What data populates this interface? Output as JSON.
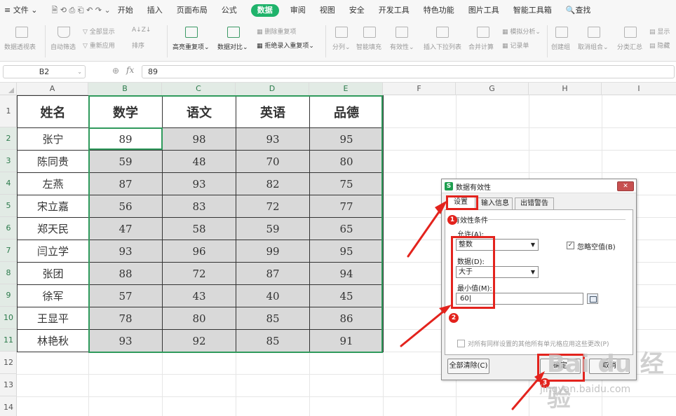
{
  "menu": {
    "file": "文件",
    "tabs": [
      "开始",
      "插入",
      "页面布局",
      "公式",
      "数据",
      "审阅",
      "视图",
      "安全",
      "开发工具",
      "特色功能",
      "图片工具",
      "智能工具箱"
    ],
    "active_tab": "数据",
    "search": "查找"
  },
  "ribbon": {
    "pivot": "数据透视表",
    "autofilter": "自动筛选",
    "show_all": "全部显示",
    "reapply": "重新应用",
    "sort": "排序",
    "highlight_dup": "高亮重复项",
    "compare": "数据对比",
    "remove_dup": "删除重复项",
    "reject_dup": "拒绝录入重复项",
    "split": "分列",
    "smart_fill": "智能填充",
    "validity": "有效性",
    "dropdown": "插入下拉列表",
    "consolidate": "合并计算",
    "whatif": "模拟分析",
    "record": "记录单",
    "group": "创建组",
    "ungroup": "取消组合",
    "subtotal": "分类汇总",
    "show_detail": "显示",
    "hide_detail": "隐藏"
  },
  "formula_bar": {
    "name_box": "B2",
    "fx": "fx",
    "value": "89"
  },
  "columns": [
    "A",
    "B",
    "C",
    "D",
    "E",
    "F",
    "G",
    "H",
    "I"
  ],
  "rows": [
    "1",
    "2",
    "3",
    "4",
    "5",
    "6",
    "7",
    "8",
    "9",
    "10",
    "11",
    "12",
    "13",
    "14"
  ],
  "table": {
    "headers": [
      "姓名",
      "数学",
      "语文",
      "英语",
      "品德"
    ],
    "rows": [
      [
        "张宁",
        "89",
        "98",
        "93",
        "95"
      ],
      [
        "陈同贵",
        "59",
        "48",
        "70",
        "80"
      ],
      [
        "左燕",
        "87",
        "93",
        "82",
        "75"
      ],
      [
        "宋立嘉",
        "56",
        "83",
        "72",
        "77"
      ],
      [
        "郑天民",
        "47",
        "58",
        "59",
        "65"
      ],
      [
        "闫立学",
        "93",
        "96",
        "99",
        "95"
      ],
      [
        "张团",
        "88",
        "72",
        "87",
        "94"
      ],
      [
        "徐军",
        "57",
        "43",
        "40",
        "45"
      ],
      [
        "王显平",
        "78",
        "80",
        "85",
        "86"
      ],
      [
        "林艳秋",
        "93",
        "92",
        "85",
        "91"
      ]
    ]
  },
  "dialog": {
    "title": "数据有效性",
    "tabs": [
      "设置",
      "输入信息",
      "出错警告"
    ],
    "group": "有效性条件",
    "allow_label": "允许(A):",
    "allow_value": "整数",
    "ignore_blank": "忽略空值(B)",
    "data_label": "数据(D):",
    "data_value": "大于",
    "min_label": "最小值(M):",
    "min_value": "60",
    "apply_all": "对所有同样设置的其他所有单元格应用这些更改(P)",
    "clear_all": "全部清除(C)",
    "ok": "确定",
    "cancel": "取消"
  },
  "annotations": {
    "badge1": "1",
    "badge2": "2",
    "badge3": "3"
  },
  "watermark": {
    "logo": "Bai du 经验",
    "url": "jingyan.baidu.com"
  },
  "colors": {
    "active_tab": "#1fb36b",
    "selection": "#2f9a5c",
    "annotation": "#e3231d",
    "shade": "#d9d9d9"
  }
}
